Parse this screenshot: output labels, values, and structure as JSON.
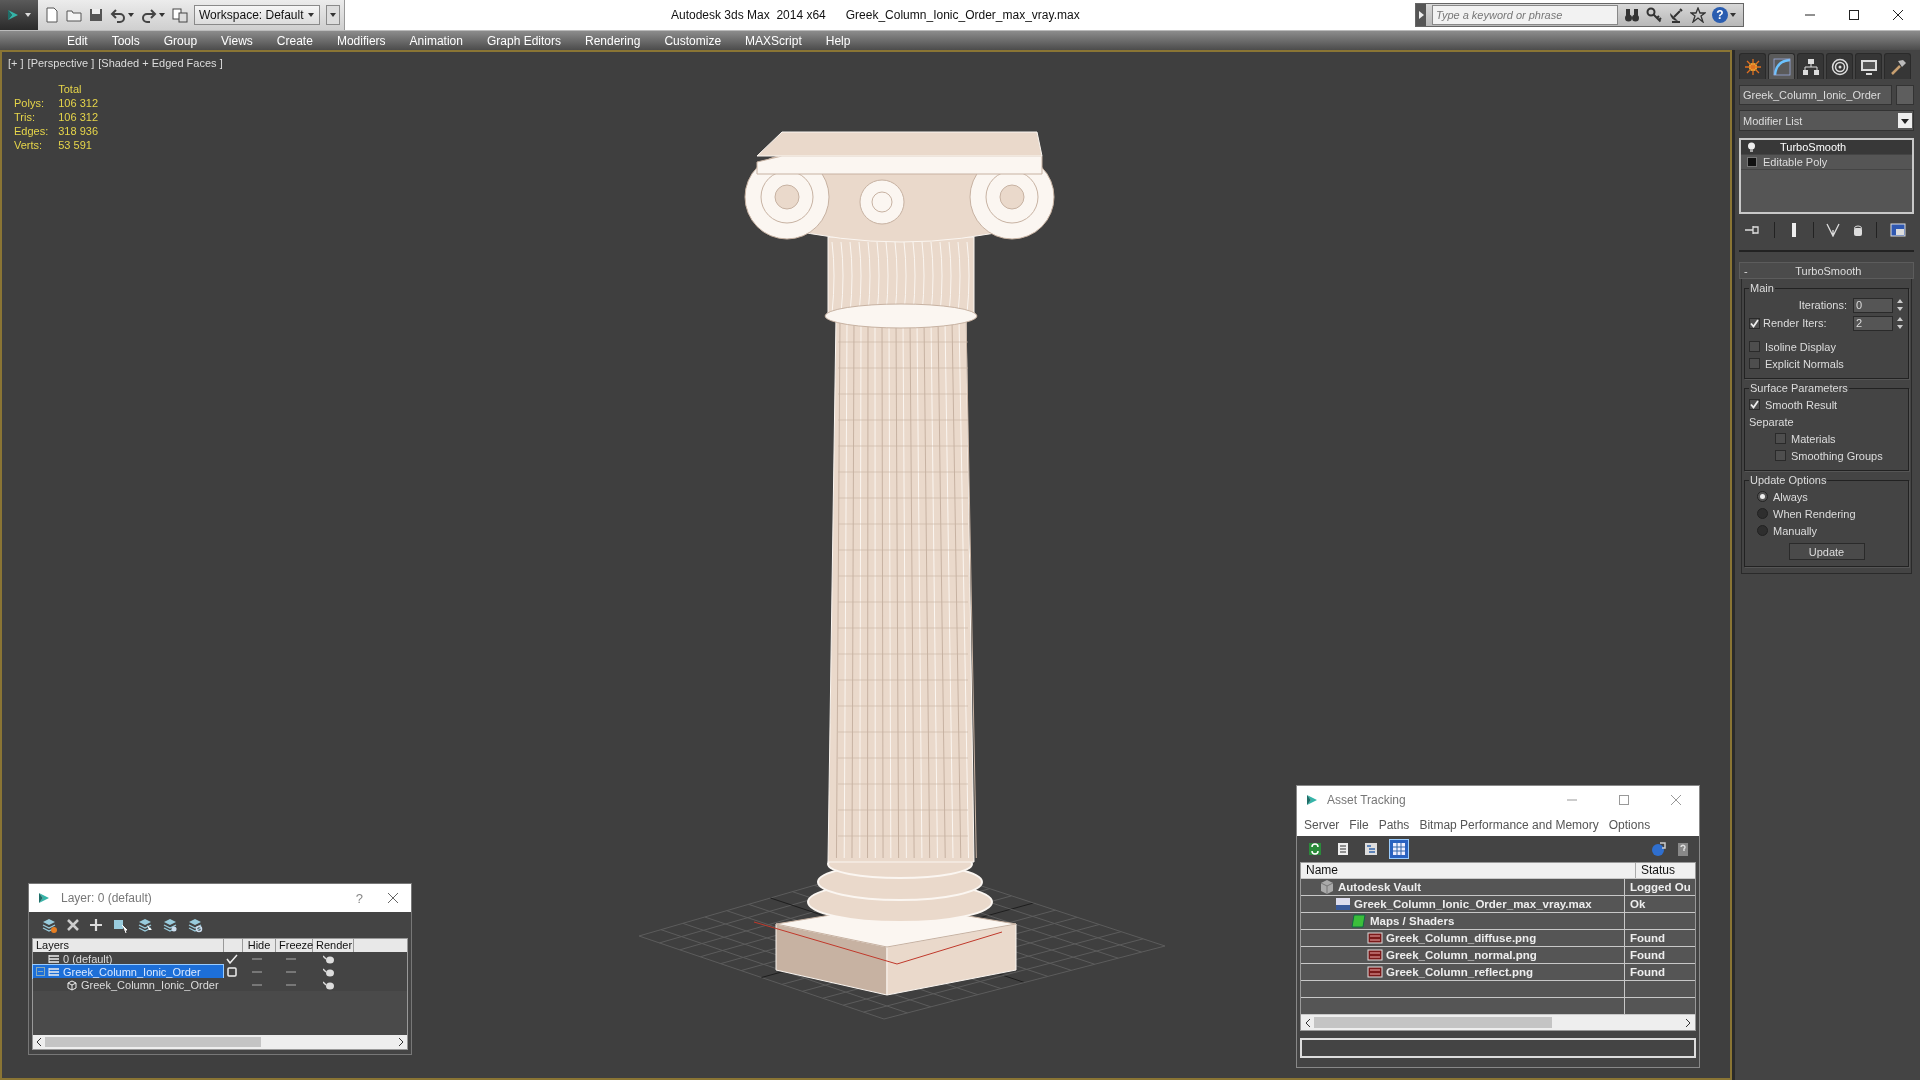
{
  "title_bar": {
    "workspace": "Workspace: Default",
    "app_title": "Autodesk 3ds Max  2014 x64",
    "file_name": "Greek_Column_Ionic_Order_max_vray.max",
    "search_placeholder": "Type a keyword or phrase",
    "help": "?"
  },
  "menu": [
    "Edit",
    "Tools",
    "Group",
    "Views",
    "Create",
    "Modifiers",
    "Animation",
    "Graph Editors",
    "Rendering",
    "Customize",
    "MAXScript",
    "Help"
  ],
  "viewport": {
    "labels": [
      "[+ ]",
      "[Perspective ]",
      "[Shaded + Edged Faces ]"
    ],
    "stats": {
      "header": "Total",
      "rows": [
        {
          "label": "Polys:",
          "value": "106 312"
        },
        {
          "label": "Tris:",
          "value": "106 312"
        },
        {
          "label": "Edges:",
          "value": "318 936"
        },
        {
          "label": "Verts:",
          "value": "53 591"
        }
      ]
    }
  },
  "command_panel": {
    "tabs": [
      {
        "selected": false
      },
      {
        "selected": true
      },
      {
        "selected": false
      },
      {
        "selected": false
      },
      {
        "selected": false
      },
      {
        "selected": false
      }
    ],
    "object_name": "Greek_Column_Ionic_Order",
    "modifier_list": "Modifier List",
    "stack": [
      {
        "label": "TurboSmooth",
        "kind": "modifier",
        "selected": true
      },
      {
        "label": "Editable Poly",
        "kind": "base",
        "selected": false
      }
    ],
    "rollout": {
      "collapse": "-",
      "title": "TurboSmooth",
      "groups": [
        {
          "legend": "Main",
          "items": [
            {
              "kind": "spinner",
              "label": "Iterations:",
              "value": "0"
            },
            {
              "kind": "check-spinner",
              "label": "Render Iters:",
              "value": "2",
              "checked": true
            },
            {
              "kind": "checkbox",
              "label": "Isoline Display",
              "checked": false
            },
            {
              "kind": "checkbox",
              "label": "Explicit Normals",
              "checked": false
            }
          ]
        },
        {
          "legend": "Surface Parameters",
          "items": [
            {
              "kind": "checkbox",
              "label": "Smooth Result",
              "checked": true
            },
            {
              "kind": "label",
              "label": "Separate"
            },
            {
              "kind": "sub-checkbox",
              "label": "Materials",
              "checked": false
            },
            {
              "kind": "sub-checkbox",
              "label": "Smoothing Groups",
              "checked": false
            }
          ]
        },
        {
          "legend": "Update Options",
          "items": [
            {
              "kind": "radio",
              "label": "Always",
              "selected": true
            },
            {
              "kind": "radio",
              "label": "When Rendering",
              "selected": false
            },
            {
              "kind": "radio",
              "label": "Manually",
              "selected": false
            },
            {
              "kind": "button",
              "label": "Update"
            }
          ]
        }
      ]
    }
  },
  "layer_dialog": {
    "title": "Layer: 0 (default)",
    "help": "?",
    "columns": [
      "Layers",
      "Hide",
      "Freeze",
      "Render"
    ],
    "layers": [
      {
        "name": "0 (default)",
        "kind": "layer",
        "current": true,
        "selected": false
      },
      {
        "name": "Greek_Column_Ionic_Order",
        "kind": "layer",
        "current": false,
        "selected": true,
        "expanded": true,
        "children": [
          {
            "name": "Greek_Column_Ionic_Order",
            "kind": "object",
            "selected": false
          }
        ]
      }
    ]
  },
  "asset_tracking": {
    "title": "Asset Tracking",
    "menu": [
      "Server",
      "File",
      "Paths",
      "Bitmap Performance and Memory",
      "Options"
    ],
    "view_buttons": [
      {
        "selected": false
      },
      {
        "selected": false
      },
      {
        "selected": false
      },
      {
        "selected": true
      }
    ],
    "columns": [
      "Name",
      "Status"
    ],
    "assets": [
      {
        "name": "Autodesk Vault",
        "kind": "vault",
        "status": "Logged Ou",
        "children": [
          {
            "name": "Greek_Column_Ionic_Order_max_vray.max",
            "kind": "scene",
            "status": "Ok",
            "children": [
              {
                "name": "Maps / Shaders",
                "kind": "folder",
                "children": [
                  {
                    "name": "Greek_Column_diffuse.png",
                    "kind": "image",
                    "status": "Found"
                  },
                  {
                    "name": "Greek_Column_normal.png",
                    "kind": "image",
                    "status": "Found"
                  },
                  {
                    "name": "Greek_Column_reflect.png",
                    "kind": "image",
                    "status": "Found"
                  }
                ]
              }
            ]
          }
        ]
      }
    ]
  }
}
